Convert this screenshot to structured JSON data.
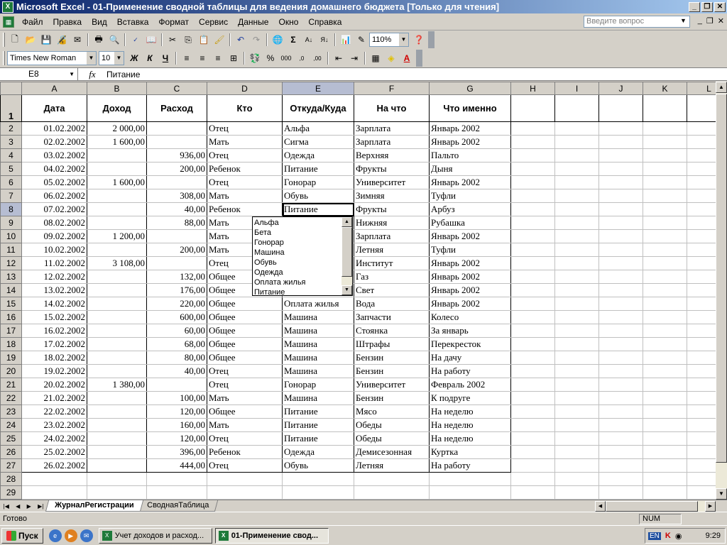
{
  "window": {
    "title": "Microsoft Excel - 01-Применение сводной таблицы для ведения домашнего бюджета  [Только для чтения]",
    "min": "_",
    "restore": "❐",
    "close": "✕"
  },
  "menu": {
    "items": [
      "Файл",
      "Правка",
      "Вид",
      "Вставка",
      "Формат",
      "Сервис",
      "Данные",
      "Окно",
      "Справка"
    ],
    "help_placeholder": "Введите вопрос",
    "doc_min": "_",
    "doc_restore": "❐",
    "doc_close": "✕"
  },
  "toolbar": {
    "zoom": "110%",
    "font": "Times New Roman",
    "size": "10"
  },
  "formula": {
    "cell": "E8",
    "fx": "fx",
    "value": "Питание"
  },
  "columns": [
    "A",
    "B",
    "C",
    "D",
    "E",
    "F",
    "G",
    "H",
    "I",
    "J",
    "K",
    "L"
  ],
  "header": [
    "Дата",
    "Доход",
    "Расход",
    "Кто",
    "Откуда/Куда",
    "На что",
    "Что именно"
  ],
  "rows": [
    [
      "01.02.2002",
      "2 000,00",
      "",
      "Отец",
      "Альфа",
      "Зарплата",
      "Январь 2002"
    ],
    [
      "02.02.2002",
      "1 600,00",
      "",
      "Мать",
      "Сигма",
      "Зарплата",
      "Январь 2002"
    ],
    [
      "03.02.2002",
      "",
      "936,00",
      "Отец",
      "Одежда",
      "Верхняя",
      "Пальто"
    ],
    [
      "04.02.2002",
      "",
      "200,00",
      "Ребенок",
      "Питание",
      "Фрукты",
      "Дыня"
    ],
    [
      "05.02.2002",
      "1 600,00",
      "",
      "Отец",
      "Гонорар",
      "Университет",
      "Январь 2002"
    ],
    [
      "06.02.2002",
      "",
      "308,00",
      "Мать",
      "Обувь",
      "Зимняя",
      "Туфли"
    ],
    [
      "07.02.2002",
      "",
      "40,00",
      "Ребенок",
      "Питание",
      "Фрукты",
      "Арбуз"
    ],
    [
      "08.02.2002",
      "",
      "88,00",
      "Мать",
      "",
      "Нижняя",
      "Рубашка"
    ],
    [
      "09.02.2002",
      "1 200,00",
      "",
      "Мать",
      "",
      "Зарплата",
      "Январь 2002"
    ],
    [
      "10.02.2002",
      "",
      "200,00",
      "Мать",
      "",
      "Летняя",
      "Туфли"
    ],
    [
      "11.02.2002",
      "3 108,00",
      "",
      "Отец",
      "",
      "Институт",
      "Январь 2002"
    ],
    [
      "12.02.2002",
      "",
      "132,00",
      "Общее",
      "",
      "Газ",
      "Январь 2002"
    ],
    [
      "13.02.2002",
      "",
      "176,00",
      "Общее",
      "",
      "Свет",
      "Январь 2002"
    ],
    [
      "14.02.2002",
      "",
      "220,00",
      "Общее",
      "Оплата жилья",
      "Вода",
      "Январь 2002"
    ],
    [
      "15.02.2002",
      "",
      "600,00",
      "Общее",
      "Машина",
      "Запчасти",
      "Колесо"
    ],
    [
      "16.02.2002",
      "",
      "60,00",
      "Общее",
      "Машина",
      "Стоянка",
      "За январь"
    ],
    [
      "17.02.2002",
      "",
      "68,00",
      "Общее",
      "Машина",
      "Штрафы",
      "Перекресток"
    ],
    [
      "18.02.2002",
      "",
      "80,00",
      "Общее",
      "Машина",
      "Бензин",
      "На дачу"
    ],
    [
      "19.02.2002",
      "",
      "40,00",
      "Отец",
      "Машина",
      "Бензин",
      "На работу"
    ],
    [
      "20.02.2002",
      "1 380,00",
      "",
      "Отец",
      "Гонорар",
      "Университет",
      "Февраль 2002"
    ],
    [
      "21.02.2002",
      "",
      "100,00",
      "Мать",
      "Машина",
      "Бензин",
      "К подруге"
    ],
    [
      "22.02.2002",
      "",
      "120,00",
      "Общее",
      "Питание",
      "Мясо",
      "На неделю"
    ],
    [
      "23.02.2002",
      "",
      "160,00",
      "Мать",
      "Питание",
      "Обеды",
      "На неделю"
    ],
    [
      "24.02.2002",
      "",
      "120,00",
      "Отец",
      "Питание",
      "Обеды",
      "На неделю"
    ],
    [
      "25.02.2002",
      "",
      "396,00",
      "Ребенок",
      "Одежда",
      "Демисезонная",
      "Куртка"
    ],
    [
      "26.02.2002",
      "",
      "444,00",
      "Отец",
      "Обувь",
      "Летняя",
      "На работу"
    ]
  ],
  "dropdown": {
    "items": [
      "Альфа",
      "Бета",
      "Гонорар",
      "Машина",
      "Обувь",
      "Одежда",
      "Оплата жилья",
      "Питание"
    ]
  },
  "sheets": {
    "tabs": [
      "ЖурналРегистрации",
      "СводнаяТаблица"
    ]
  },
  "status": {
    "ready": "Готово",
    "num": "NUM"
  },
  "taskbar": {
    "start": "Пуск",
    "items": [
      "Учет доходов и расход...",
      "01-Применение свод..."
    ],
    "lang": "EN",
    "time": "9:29"
  }
}
